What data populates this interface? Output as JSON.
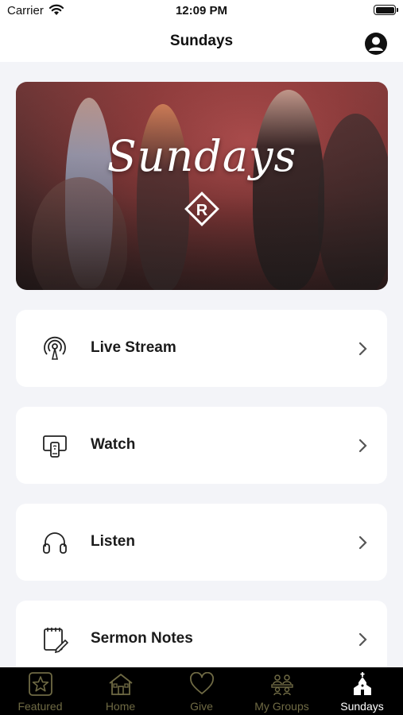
{
  "status_bar": {
    "carrier": "Carrier",
    "time": "12:09 PM"
  },
  "nav": {
    "title": "Sundays",
    "profile_icon": "profile-icon"
  },
  "hero": {
    "script_text": "Sundays",
    "logo_letter": "R"
  },
  "menu": [
    {
      "label": "Live Stream",
      "icon": "broadcast-icon"
    },
    {
      "label": "Watch",
      "icon": "tv-device-icon"
    },
    {
      "label": "Listen",
      "icon": "headphones-icon"
    },
    {
      "label": "Sermon Notes",
      "icon": "notepad-icon"
    }
  ],
  "tabs": [
    {
      "label": "Featured",
      "icon": "star-icon",
      "active": false
    },
    {
      "label": "Home",
      "icon": "house-icon",
      "active": false
    },
    {
      "label": "Give",
      "icon": "heart-icon",
      "active": false
    },
    {
      "label": "My Groups",
      "icon": "groups-icon",
      "active": false
    },
    {
      "label": "Sundays",
      "icon": "church-icon",
      "active": true
    }
  ],
  "colors": {
    "tab_inactive": "#6f6a44",
    "tab_active": "#ffffff",
    "tabbar_bg": "#000000",
    "page_bg": "#f3f4f8"
  }
}
